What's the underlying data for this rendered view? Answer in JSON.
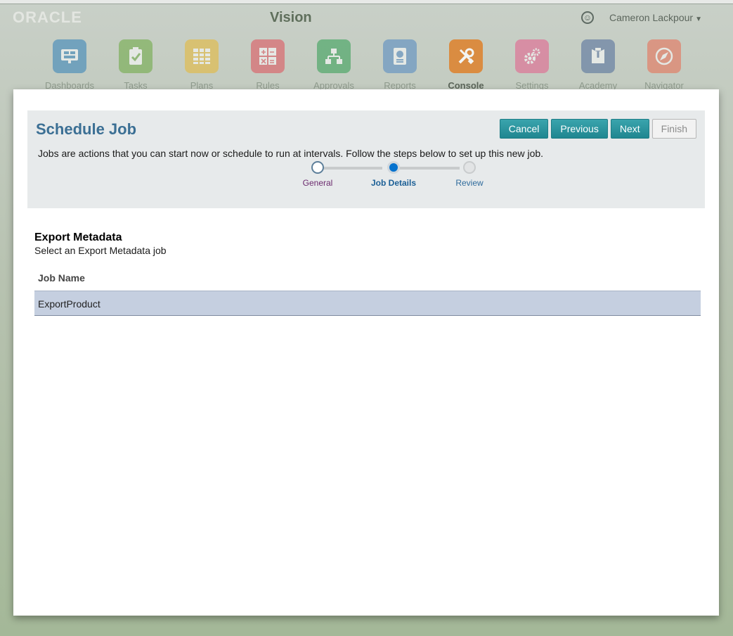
{
  "header": {
    "brand": "ORACLE",
    "app_title": "Vision",
    "user_name": "Cameron Lackpour"
  },
  "nav": {
    "items": [
      {
        "label": "Dashboards",
        "icon": "dashboard-icon",
        "color": "#2f7fb8"
      },
      {
        "label": "Tasks",
        "icon": "tasks-icon",
        "color": "#6aa83f"
      },
      {
        "label": "Plans",
        "icon": "plans-grid-icon",
        "color": "#e8b830"
      },
      {
        "label": "Rules",
        "icon": "rules-calculator-icon",
        "color": "#e04d57"
      },
      {
        "label": "Approvals",
        "icon": "approvals-hierarchy-icon",
        "color": "#2f9d50"
      },
      {
        "label": "Reports",
        "icon": "reports-icon",
        "color": "#4f87c2"
      },
      {
        "label": "Console",
        "icon": "console-tools-icon",
        "color": "#e07c21",
        "active": true
      },
      {
        "label": "Settings",
        "icon": "settings-gears-icon",
        "color": "#e55b8a"
      },
      {
        "label": "Academy",
        "icon": "academy-icon",
        "color": "#4d6a9a"
      },
      {
        "label": "Navigator",
        "icon": "navigator-compass-icon",
        "color": "#ea6a4f"
      }
    ]
  },
  "dialog": {
    "title": "Schedule Job",
    "buttons": {
      "cancel": "Cancel",
      "previous": "Previous",
      "next": "Next",
      "finish": "Finish"
    },
    "description": "Jobs are actions that you can start now or schedule to run at intervals. Follow the steps below to set up this new job.",
    "steps": [
      {
        "label": "General",
        "state": "visited"
      },
      {
        "label": "Job Details",
        "state": "current"
      },
      {
        "label": "Review",
        "state": "future"
      }
    ]
  },
  "content": {
    "section_title": "Export Metadata",
    "section_subtitle": "Select an Export Metadata job",
    "table": {
      "columns": [
        "Job Name"
      ],
      "rows": [
        [
          "ExportProduct"
        ]
      ],
      "selected_row": 0,
      "selected_color": "#c5cfe0"
    }
  }
}
